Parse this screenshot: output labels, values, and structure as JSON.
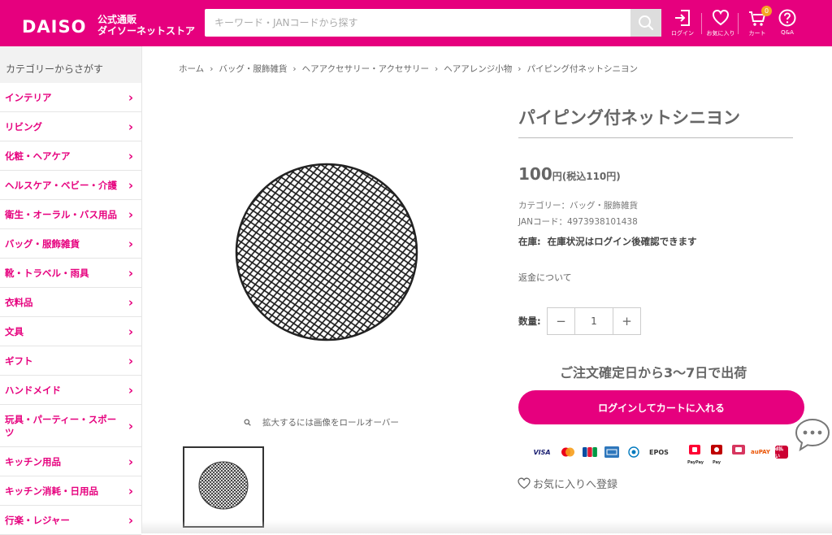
{
  "header": {
    "logo": "DAISO",
    "logo_sub1": "公式通販",
    "logo_sub2": "ダイソーネットストア",
    "search_placeholder": "キーワード・JANコードから探す",
    "login_label": "ログイン",
    "favorites_label": "お気に入り",
    "cart_label": "カート",
    "cart_count": "0",
    "qa_label": "Q&A"
  },
  "sidebar": {
    "heading": "カテゴリーからさがす",
    "items": [
      {
        "label": "インテリア"
      },
      {
        "label": "リビング"
      },
      {
        "label": "化粧・ヘアケア"
      },
      {
        "label": "ヘルスケア・ベビー・介護"
      },
      {
        "label": "衛生・オーラル・バス用品"
      },
      {
        "label": "バッグ・服飾雑貨"
      },
      {
        "label": "靴・トラベル・雨具"
      },
      {
        "label": "衣料品"
      },
      {
        "label": "文具"
      },
      {
        "label": "ギフト"
      },
      {
        "label": "ハンドメイド"
      },
      {
        "label": "玩具・パーティー・スポーツ"
      },
      {
        "label": "キッチン用品"
      },
      {
        "label": "キッチン消耗・日用品"
      },
      {
        "label": "行楽・レジャー"
      }
    ]
  },
  "breadcrumb": [
    "ホーム",
    "バッグ・服飾雑貨",
    "ヘアアクセサリー・アクセサリー",
    "ヘアアレンジ小物",
    "パイピング付ネットシニヨン"
  ],
  "gallery": {
    "zoom_note": "拡大するには画像をロールオーバー"
  },
  "product": {
    "title": "パイピング付ネットシニヨン",
    "price": "100",
    "price_suffix": "円(税込110円)",
    "category": "カテゴリー：バッグ・服飾雑貨",
    "jan": "JANコード：4973938101438",
    "stock_label": "在庫:",
    "stock_value": "在庫状況はログイン後確認できます",
    "refund": "返金について",
    "quantity_label": "数量:",
    "quantity": "1",
    "shipping": "ご注文確定日から3〜7日で出荷",
    "cart_button": "ログインしてカートに入れる",
    "favorite": "お気に入りへ登録"
  },
  "payments": [
    "VISA",
    "EPOS",
    "PayPay",
    "Pay",
    "auPAY",
    "d払い"
  ],
  "colors": {
    "brand": "#e6007e",
    "badge": "#f5a623"
  }
}
